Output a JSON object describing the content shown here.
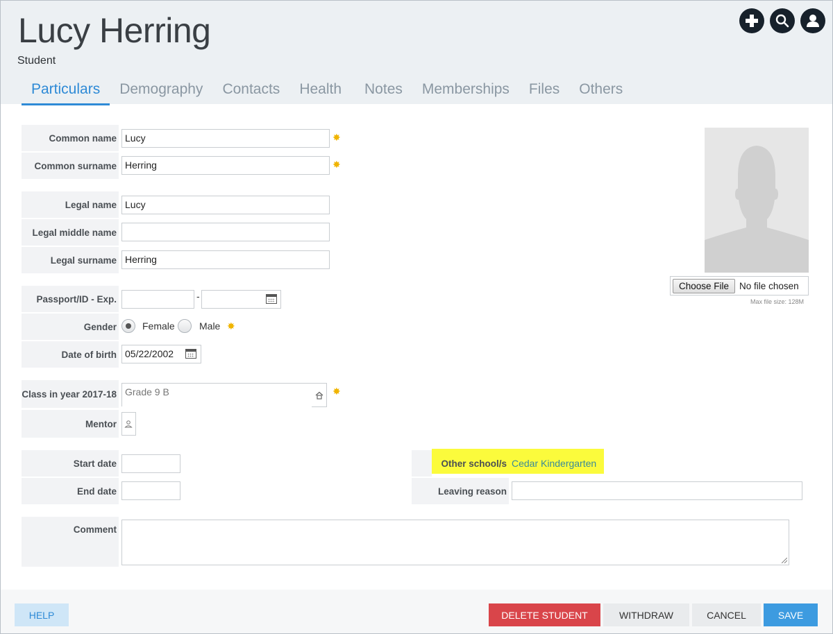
{
  "header": {
    "title": "Lucy Herring",
    "subtitle": "Student",
    "icons": [
      "plus-circle-icon",
      "search-icon",
      "user-icon"
    ]
  },
  "tabs": [
    {
      "label": "Particulars",
      "active": true
    },
    {
      "label": "Demography"
    },
    {
      "label": "Contacts"
    },
    {
      "label": "Health"
    },
    {
      "label": "Notes"
    },
    {
      "label": "Memberships"
    },
    {
      "label": "Files"
    },
    {
      "label": "Others"
    }
  ],
  "form": {
    "common_name": {
      "label": "Common name",
      "value": "Lucy",
      "required": true
    },
    "common_surname": {
      "label": "Common surname",
      "value": "Herring",
      "required": true
    },
    "legal_name": {
      "label": "Legal name",
      "value": "Lucy"
    },
    "legal_middle_name": {
      "label": "Legal middle name",
      "value": ""
    },
    "legal_surname": {
      "label": "Legal surname",
      "value": "Herring"
    },
    "passport": {
      "label": "Passport/ID - Exp.",
      "value": "",
      "expiry": "",
      "separator": "-"
    },
    "gender": {
      "label": "Gender",
      "options": [
        "Female",
        "Male"
      ],
      "selected": "Female",
      "required": true
    },
    "dob": {
      "label": "Date of birth",
      "value": "05/22/2002"
    },
    "class": {
      "label": "Class in year 2017-18",
      "value": "Grade 9 B",
      "required": true
    },
    "mentor": {
      "label": "Mentor",
      "value": ""
    },
    "start_date": {
      "label": "Start date",
      "value": ""
    },
    "end_date": {
      "label": "End date",
      "value": ""
    },
    "other_schools": {
      "label": "Other school/s",
      "value": "Cedar Kindergarten"
    },
    "leaving_reason": {
      "label": "Leaving reason",
      "value": ""
    },
    "comment": {
      "label": "Comment",
      "value": ""
    }
  },
  "photo": {
    "choose_label": "Choose File",
    "no_file": "No file chosen",
    "max_size": "Max file size: 128M"
  },
  "footer": {
    "help": "HELP",
    "delete": "DELETE STUDENT",
    "withdraw": "WITHDRAW",
    "cancel": "CANCEL",
    "save": "SAVE"
  },
  "colors": {
    "accent": "#2e8ad6",
    "danger": "#d9454a",
    "required": "#f0b400",
    "highlight": "#fbfb3c"
  }
}
